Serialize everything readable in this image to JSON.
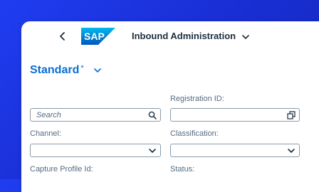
{
  "header": {
    "logo_text": "SAP",
    "app_title": "Inbound Administration"
  },
  "variant": {
    "name": "Standard",
    "modified_marker": "*"
  },
  "filters": {
    "search": {
      "placeholder": "Search",
      "value": ""
    },
    "registration_id": {
      "label": "Registration ID:",
      "value": ""
    },
    "channel": {
      "label": "Channel:",
      "value": ""
    },
    "classification": {
      "label": "Classification:",
      "value": ""
    },
    "capture_profile_id": {
      "label": "Capture Profile Id:"
    },
    "status": {
      "label": "Status:"
    }
  },
  "colors": {
    "accent": "#0a6ed1",
    "background": "#1f3df0",
    "text": "#1d2d3e"
  },
  "icons": [
    "back-arrow-icon",
    "chevron-down-icon",
    "search-icon",
    "value-help-icon"
  ]
}
